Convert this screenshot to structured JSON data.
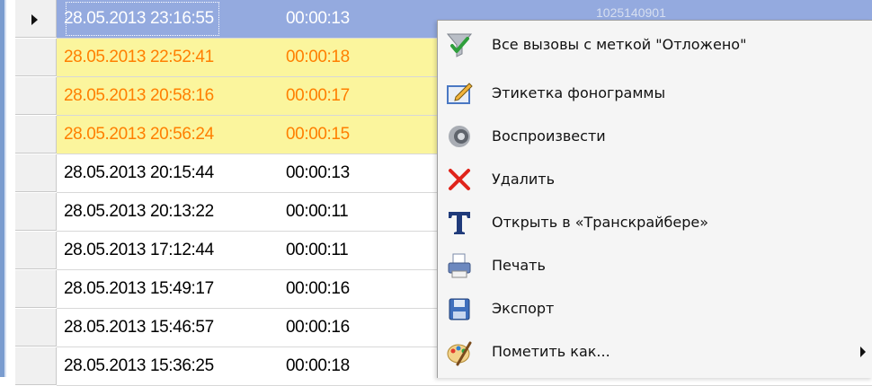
{
  "grid": {
    "rows": [
      {
        "datetime": "28.05.2013 23:16:55",
        "duration": "00:00:13",
        "state": "selected",
        "extra": "1025140901"
      },
      {
        "datetime": "28.05.2013 22:52:41",
        "duration": "00:00:18",
        "state": "marked"
      },
      {
        "datetime": "28.05.2013 20:58:16",
        "duration": "00:00:17",
        "state": "marked"
      },
      {
        "datetime": "28.05.2013 20:56:24",
        "duration": "00:00:15",
        "state": "marked"
      },
      {
        "datetime": "28.05.2013 20:15:44",
        "duration": "00:00:13",
        "state": "normal"
      },
      {
        "datetime": "28.05.2013 20:13:22",
        "duration": "00:00:11",
        "state": "normal"
      },
      {
        "datetime": "28.05.2013 17:12:44",
        "duration": "00:00:11",
        "state": "normal"
      },
      {
        "datetime": "28.05.2013 15:49:17",
        "duration": "00:00:16",
        "state": "normal"
      },
      {
        "datetime": "28.05.2013 15:46:57",
        "duration": "00:00:16",
        "state": "normal"
      },
      {
        "datetime": "28.05.2013 15:36:25",
        "duration": "00:00:18",
        "state": "normal"
      }
    ],
    "colors": {
      "selected": "#94aadf",
      "marked_bg": "#fbf59d",
      "marked_text": "#ff7f00"
    }
  },
  "context_menu": {
    "items": [
      {
        "label": "Все вызовы с меткой \"Отложено\"",
        "icon": "filter-funnel-icon"
      },
      {
        "label": "Этикетка фонограммы",
        "icon": "label-edit-icon"
      },
      {
        "label": "Воспроизвести",
        "icon": "speaker-play-icon"
      },
      {
        "label": "Удалить",
        "icon": "delete-x-icon"
      },
      {
        "label": "Открыть в «Транскрайбере»",
        "icon": "transcriber-t-icon"
      },
      {
        "label": "Печать",
        "icon": "printer-icon"
      },
      {
        "label": "Экспорт",
        "icon": "export-disk-icon"
      },
      {
        "label": "Пометить как...",
        "icon": "mark-palette-icon",
        "submenu": true
      }
    ]
  }
}
